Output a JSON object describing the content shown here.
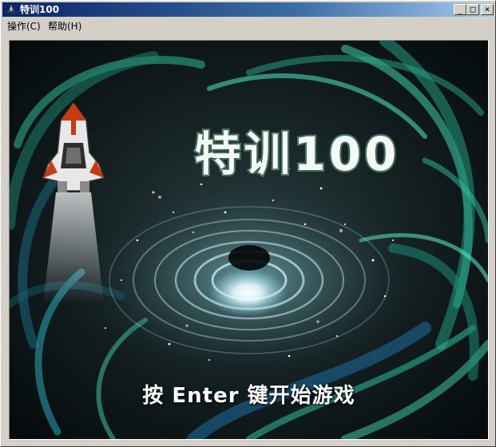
{
  "window": {
    "title": "特训100",
    "icon": "app-icon",
    "controls": {
      "minimize": "_",
      "maximize": "□",
      "close": "×"
    }
  },
  "menu": [
    {
      "label": "操作(C)"
    },
    {
      "label": "帮助(H)"
    }
  ],
  "game": {
    "title": "特训100",
    "start_prompt": "按 Enter 键开始游戏"
  },
  "colors": {
    "titlebar_start": "#0a246a",
    "titlebar_end": "#a6caf0",
    "swirl_teal": "#36c6a0",
    "ship_red": "#c83a10"
  }
}
